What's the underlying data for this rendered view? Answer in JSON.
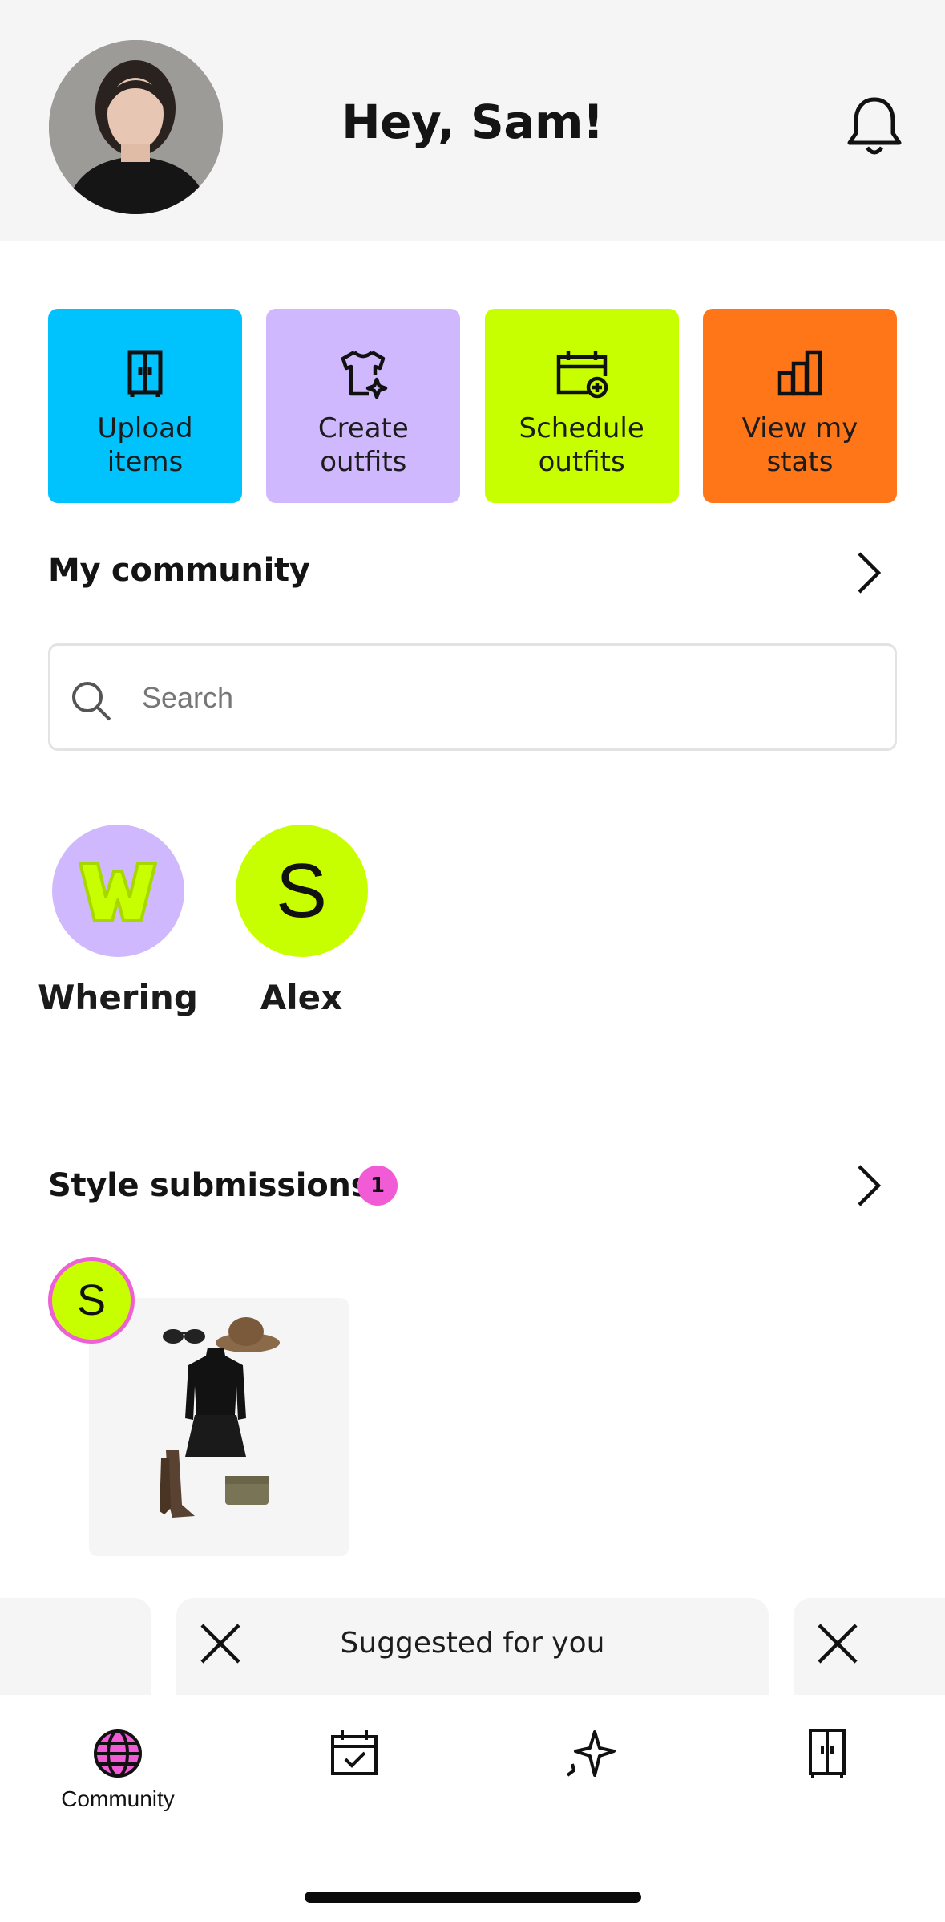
{
  "header": {
    "greeting": "Hey, Sam!"
  },
  "quick_actions": [
    {
      "label": "Upload items",
      "color": "#00c2fd",
      "icon": "wardrobe-icon"
    },
    {
      "label": "Create outfits",
      "color": "#cfb8fd",
      "icon": "shirt-sparkle-icon"
    },
    {
      "label": "Schedule outfits",
      "color": "#c8ff00",
      "icon": "calendar-add-icon"
    },
    {
      "label": "View my stats",
      "color": "#ff7619",
      "icon": "bar-chart-icon"
    }
  ],
  "community": {
    "title": "My community",
    "search_placeholder": "Search",
    "members": [
      {
        "name": "Whering",
        "avatar_color": "#cfb8fd",
        "initial_color": "#c8ff00"
      },
      {
        "name": "Alex",
        "initial": "S",
        "avatar_color": "#c8ff00"
      }
    ]
  },
  "style_submissions": {
    "title": "Style submissions",
    "count": "1",
    "items": [
      {
        "initial": "S"
      }
    ]
  },
  "suggested": {
    "title": "Suggested for you"
  },
  "tabbar": {
    "tabs": [
      {
        "label": "Community",
        "icon": "globe-icon",
        "active": true,
        "active_color": "#f25bd6"
      },
      {
        "label": "",
        "icon": "calendar-check-icon"
      },
      {
        "label": "",
        "icon": "sparkle-icon"
      },
      {
        "label": "",
        "icon": "wardrobe-icon"
      }
    ]
  }
}
